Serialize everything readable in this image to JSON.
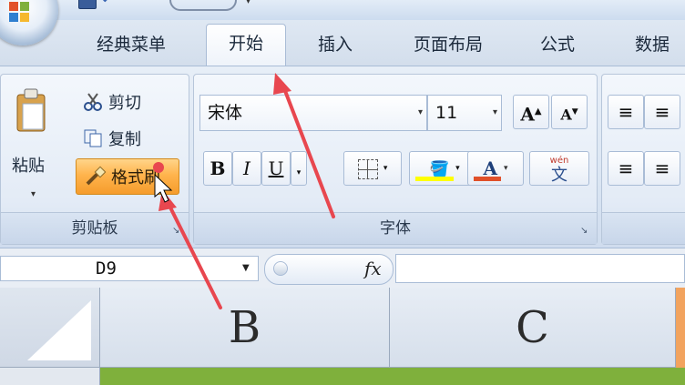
{
  "tabs": [
    {
      "label": "经典菜单",
      "active": false
    },
    {
      "label": "开始",
      "active": true
    },
    {
      "label": "插入",
      "active": false
    },
    {
      "label": "页面布局",
      "active": false
    },
    {
      "label": "公式",
      "active": false
    },
    {
      "label": "数据",
      "active": false
    }
  ],
  "clipboard": {
    "paste_label": "粘贴",
    "cut_label": "剪切",
    "copy_label": "复制",
    "format_painter_label": "格式刷",
    "group_label": "剪贴板"
  },
  "font": {
    "name": "宋体",
    "size": "11",
    "grow_label": "A",
    "shrink_label": "A",
    "bold": "B",
    "italic": "I",
    "underline": "U",
    "font_color_label": "A",
    "phonetic_top": "wén",
    "phonetic_bottom": "文",
    "group_label": "字体"
  },
  "formula_bar": {
    "cell_ref": "D9",
    "fx_label": "fx",
    "formula_value": ""
  },
  "sheet": {
    "column_headers": [
      "B",
      "C"
    ]
  },
  "colors": {
    "annotation_arrow": "#e8474f",
    "highlight_fill": "#ffff00",
    "font_color_bar": "#e0502a",
    "format_painter_active": "#ffb44d"
  }
}
